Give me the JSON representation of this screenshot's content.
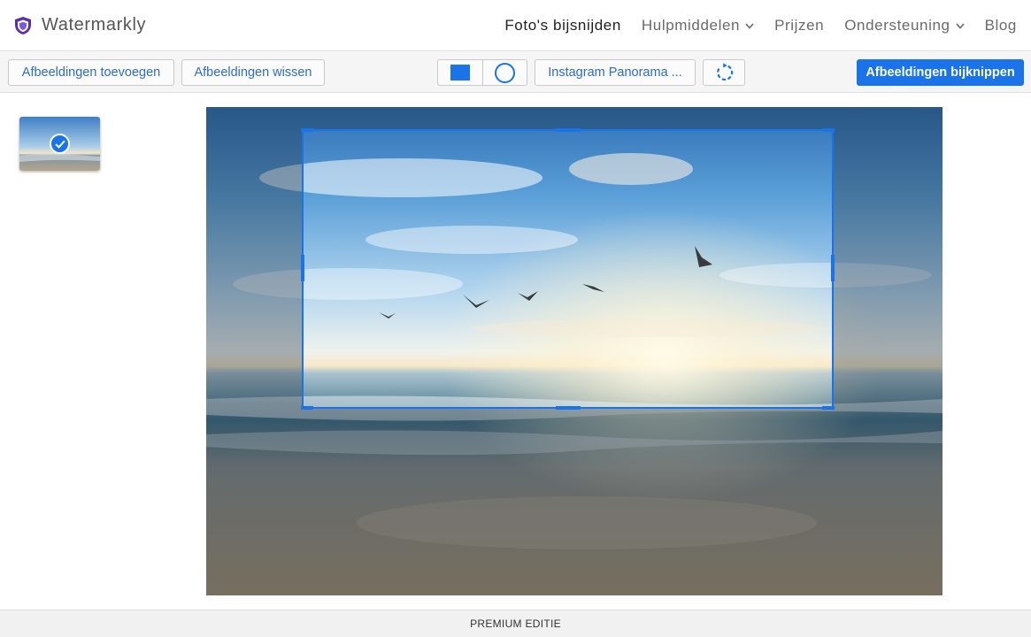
{
  "app": {
    "name": "Watermarkly",
    "logo_icon": "shield-logo-icon",
    "brand_color": "#5b2fa8"
  },
  "nav": {
    "items": [
      {
        "label": "Foto's bijsnijden",
        "active": true,
        "dropdown": false
      },
      {
        "label": "Hulpmiddelen",
        "active": false,
        "dropdown": true
      },
      {
        "label": "Prijzen",
        "active": false,
        "dropdown": false
      },
      {
        "label": "Ondersteuning",
        "active": false,
        "dropdown": true
      },
      {
        "label": "Blog",
        "active": false,
        "dropdown": false
      }
    ]
  },
  "toolbar": {
    "add_label": "Afbeeldingen toevoegen",
    "clear_label": "Afbeeldingen wissen",
    "shape_rect_icon": "rectangle-shape-icon",
    "shape_circle_icon": "circle-shape-icon",
    "preset_label": "Instagram Panorama ...",
    "rotate_icon": "rotate-icon",
    "crop_label": "Afbeeldingen bijknippen",
    "accent_color": "#1a73e8"
  },
  "sidebar": {
    "thumbnail_icon": "check-icon",
    "thumbnail_selected": true
  },
  "editor": {
    "crop_frame_color": "#1a73e8"
  },
  "footer": {
    "label": "PREMIUM EDITIE"
  }
}
